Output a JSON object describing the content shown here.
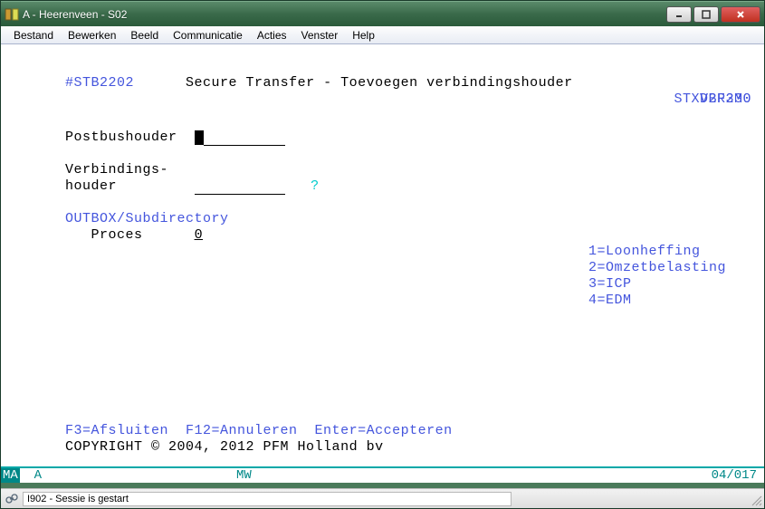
{
  "window": {
    "title": "A - Heerenveen - S02"
  },
  "menu": {
    "items": [
      "Bestand",
      "Bewerken",
      "Beeld",
      "Communicatie",
      "Acties",
      "Venster",
      "Help"
    ]
  },
  "screen": {
    "program_id": "#STB2202",
    "title": "Secure Transfer - Toevoegen verbindingshouder",
    "db_id": "STXDBF230",
    "version": "V2R3M0",
    "field1_label": "Postbushouder",
    "field1_value": "",
    "field2_label_line1": "Verbindings-",
    "field2_label_line2": "houder",
    "field2_value": "",
    "help_marker": "?",
    "section_header": "OUTBOX/Subdirectory",
    "proces_label": "Proces",
    "proces_value": "0",
    "options": {
      "opt1": "1=Loonheffing",
      "opt2": "2=Omzetbelasting",
      "opt3": "3=ICP",
      "opt4": "4=EDM"
    },
    "fkeys": "F3=Afsluiten  F12=Annuleren  Enter=Accepteren",
    "copyright": "COPYRIGHT © 2004, 2012 PFM Holland bv"
  },
  "oia": {
    "ma_indicator": "MA",
    "session": "A",
    "status_code": "MW",
    "cursor_pos": "04/017"
  },
  "statusbar": {
    "message": "I902 - Sessie is gestart"
  }
}
